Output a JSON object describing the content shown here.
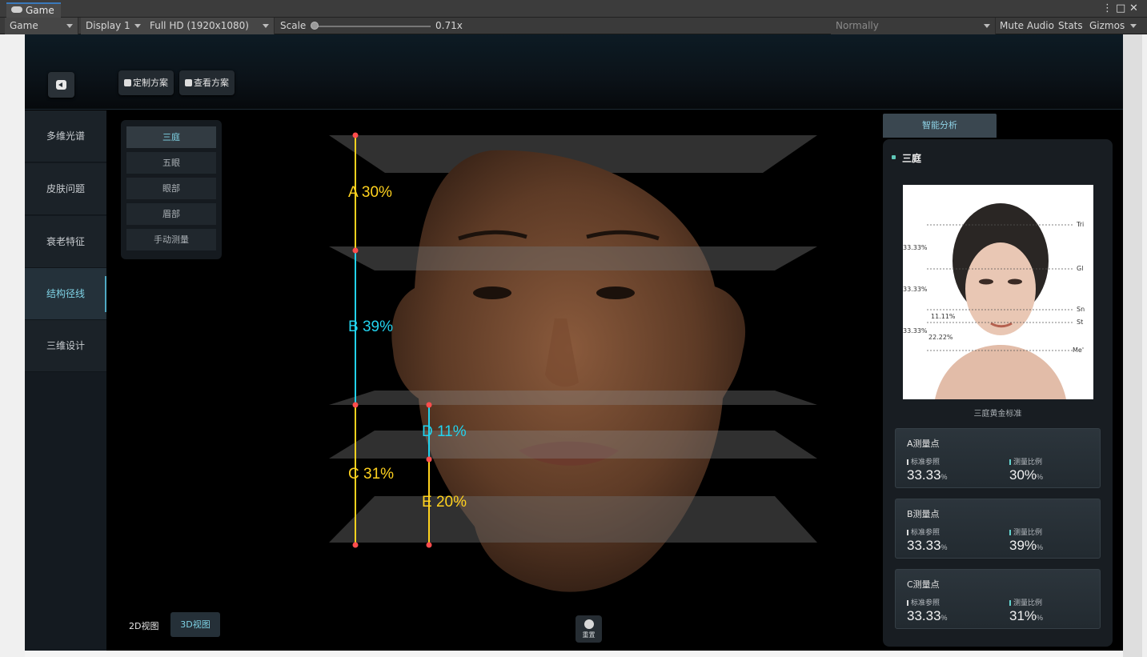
{
  "window": {
    "tab_title": "Game"
  },
  "toolbar": {
    "view_mode": "Game",
    "display": "Display 1",
    "resolution": "Full HD (1920x1080)",
    "scale_label": "Scale",
    "scale_value": "0.71x",
    "play_mode": "Normally",
    "mute_audio": "Mute Audio",
    "stats": "Stats",
    "gizmos": "Gizmos"
  },
  "app": {
    "top_buttons": {
      "custom_plan": "定制方案",
      "view_plan": "查看方案"
    },
    "sidebar": [
      {
        "label": "多维光谱",
        "active": false
      },
      {
        "label": "皮肤问题",
        "active": false
      },
      {
        "label": "衰老特征",
        "active": false
      },
      {
        "label": "结构径线",
        "active": true
      },
      {
        "label": "三维设计",
        "active": false
      }
    ],
    "submenu": [
      {
        "label": "三庭",
        "active": true
      },
      {
        "label": "五眼",
        "active": false
      },
      {
        "label": "眼部",
        "active": false
      },
      {
        "label": "眉部",
        "active": false
      },
      {
        "label": "手动测量",
        "active": false
      }
    ],
    "measurements": [
      {
        "letter": "A",
        "value": "30%",
        "color": "#ffd21e"
      },
      {
        "letter": "B",
        "value": "39%",
        "color": "#22d3ee"
      },
      {
        "letter": "C",
        "value": "31%",
        "color": "#ffd21e"
      },
      {
        "letter": "D",
        "value": "11%",
        "color": "#22d3ee"
      },
      {
        "letter": "E",
        "value": "20%",
        "color": "#ffd21e"
      }
    ],
    "view_toggle": {
      "v2d": "2D视图",
      "v3d": "3D视图"
    },
    "reset_label": "重置",
    "analysis": {
      "tab_label": "智能分析",
      "section_title": "三庭",
      "reference": {
        "caption": "三庭黄金标准",
        "lines": [
          "Tri",
          "Gl",
          "Sn",
          "St",
          "Me'"
        ],
        "percents": [
          "33.33%",
          "33.33%",
          "11.11%",
          "33.33%",
          "22.22%"
        ]
      },
      "cards": [
        {
          "title": "A测量点",
          "std_label": "标准参照",
          "ratio_label": "测量比例",
          "std_value": "33.33",
          "ratio_value": "30%",
          "unit": "%"
        },
        {
          "title": "B测量点",
          "std_label": "标准参照",
          "ratio_label": "测量比例",
          "std_value": "33.33",
          "ratio_value": "39%",
          "unit": "%"
        },
        {
          "title": "C测量点",
          "std_label": "标准参照",
          "ratio_label": "测量比例",
          "std_value": "33.33",
          "ratio_value": "31%",
          "unit": "%"
        }
      ]
    },
    "colors": {
      "accent": "#7fd3e6",
      "yellow": "#ffd21e",
      "cyan": "#22d3ee",
      "point": "#ff4d4d"
    }
  }
}
